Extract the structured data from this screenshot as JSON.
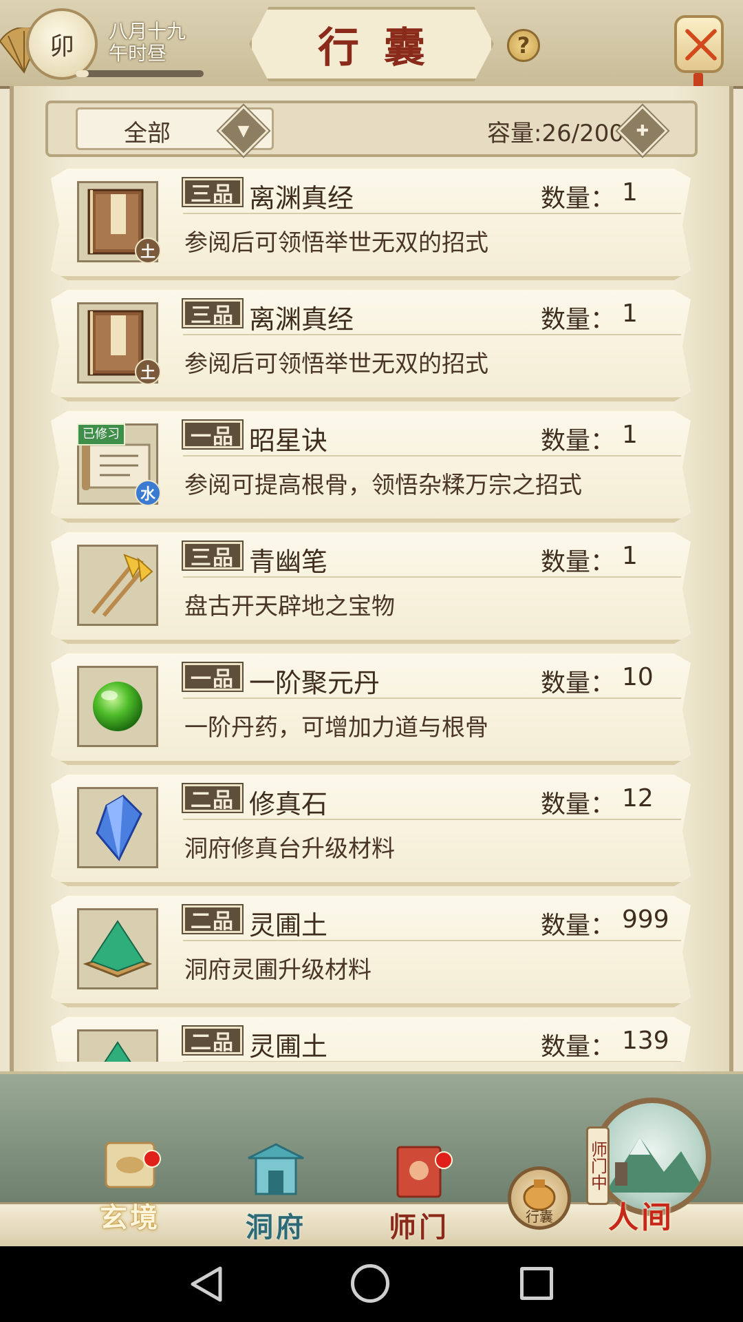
{
  "header": {
    "time_label": "卯",
    "date_line1": "八月十九",
    "date_line2": "午时昼",
    "time_progress": 0.1,
    "title": "行囊",
    "help": "?"
  },
  "filter": {
    "selected": "全部",
    "capacity": "容量:26/200"
  },
  "qty_label": "数量：",
  "items": [
    {
      "grade": "三品",
      "name": "离渊真经",
      "qty": "1",
      "desc": "参阅后可领悟举世无双的招式",
      "icon": "book-icon",
      "element": "土"
    },
    {
      "grade": "三品",
      "name": "离渊真经",
      "qty": "1",
      "desc": "参阅后可领悟举世无双的招式",
      "icon": "book-icon",
      "element": "土"
    },
    {
      "grade": "一品",
      "name": "昭星诀",
      "qty": "1",
      "desc": "参阅可提高根骨，领悟杂糅万宗之招式",
      "icon": "scroll-icon",
      "element": "水",
      "learned": "已修习"
    },
    {
      "grade": "三品",
      "name": "青幽笔",
      "qty": "1",
      "desc": "盘古开天辟地之宝物",
      "icon": "brush-icon"
    },
    {
      "grade": "一品",
      "name": "一阶聚元丹",
      "qty": "10",
      "desc": "一阶丹药，可增加力道与根骨",
      "icon": "pill-icon"
    },
    {
      "grade": "二品",
      "name": "修真石",
      "qty": "12",
      "desc": "洞府修真台升级材料",
      "icon": "crystal-icon"
    },
    {
      "grade": "二品",
      "name": "灵圃土",
      "qty": "999",
      "desc": "洞府灵圃升级材料",
      "icon": "soil-icon"
    },
    {
      "grade": "二品",
      "name": "灵圃土",
      "qty": "139",
      "desc": "",
      "icon": "soil-icon"
    }
  ],
  "nav": {
    "xuanjing": "玄境",
    "dongfu": "洞府",
    "shimen": "师门",
    "xingnang": "行囊",
    "renjian": "人间",
    "shimen_tag": "师门中"
  },
  "colors": {
    "accent_red": "#8a2a1b",
    "badge_dark": "#5d4f3a",
    "card_bg": "#fcf8ea"
  }
}
